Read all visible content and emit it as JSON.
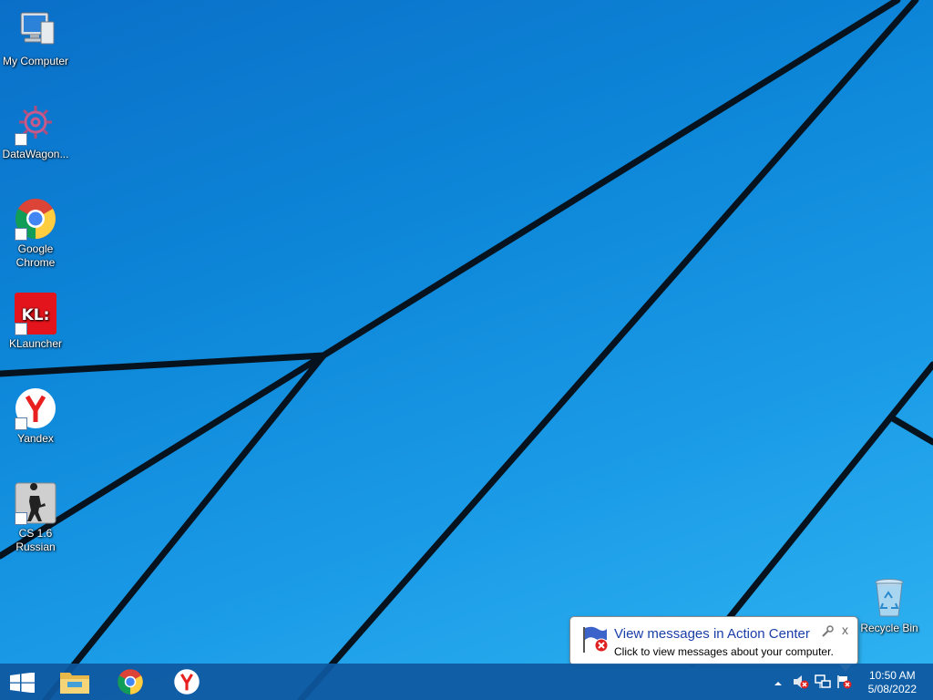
{
  "desktop": {
    "icons": [
      {
        "label": "My Computer",
        "icon": "computer-icon"
      },
      {
        "label": "DataWagon...",
        "icon": "gear-icon"
      },
      {
        "label": "Google Chrome",
        "icon": "chrome-icon"
      },
      {
        "label": "KLauncher",
        "icon": "klauncher-icon"
      },
      {
        "label": "Yandex",
        "icon": "yandex-icon"
      },
      {
        "label": "CS 1.6 Russian",
        "icon": "counter-strike-icon"
      }
    ],
    "recycle_bin": {
      "label": "Recycle Bin",
      "icon": "recycle-bin-icon"
    }
  },
  "taskbar": {
    "buttons": [
      {
        "name": "start",
        "icon": "windows-logo-icon"
      },
      {
        "name": "file-explorer",
        "icon": "folder-icon"
      },
      {
        "name": "chrome",
        "icon": "chrome-icon"
      },
      {
        "name": "yandex",
        "icon": "yandex-icon"
      }
    ],
    "tray": {
      "time": "10:50 AM",
      "date": "5/08/2022",
      "icons": [
        "show-hidden-icons-arrow",
        "speaker-muted-icon",
        "network-icon",
        "action-center-flag-icon"
      ]
    }
  },
  "balloon": {
    "title": "View messages in Action Center",
    "text": "Click to view messages about your computer.",
    "close": "x",
    "icon": "action-center-flag-icon"
  },
  "colors": {
    "wallpaper_blue": "#1a9ae6",
    "taskbar": "#0e58a0",
    "balloon_title": "#1a3ea8"
  }
}
